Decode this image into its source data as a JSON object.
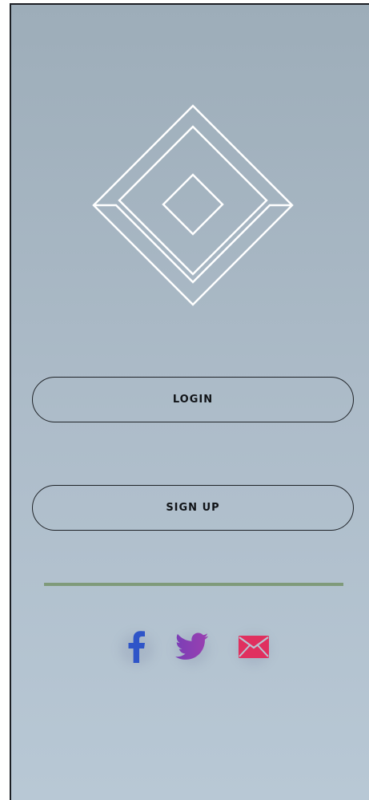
{
  "auth": {
    "login_label": "LOGIN",
    "signup_label": "SIGN UP"
  },
  "social": [
    {
      "name": "facebook-icon",
      "color": "#2f55c8"
    },
    {
      "name": "twitter-icon",
      "color": "#8a3fb8"
    },
    {
      "name": "mail-icon",
      "color": "#e0305f"
    }
  ],
  "colors": {
    "background_top": "#9dadb9",
    "background_bottom": "#b8c8d5",
    "logo_stroke": "#ffffff",
    "button_border": "#1f2328",
    "divider": "#7f9a7a"
  }
}
